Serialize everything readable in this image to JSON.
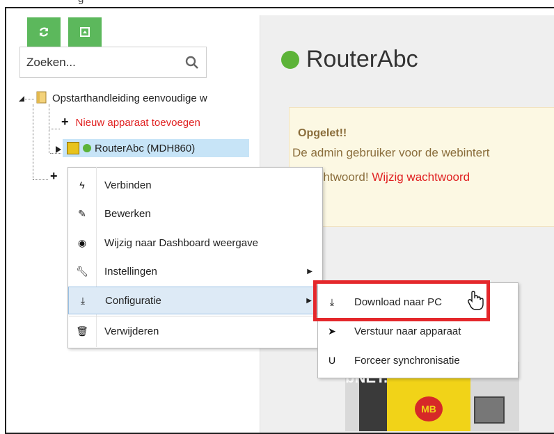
{
  "top_cut_text": "g",
  "toolbar": {
    "refresh_icon": "refresh-icon",
    "collapse_icon": "collapse-icon"
  },
  "search": {
    "placeholder": "Zoeken..."
  },
  "tree": {
    "root_label": "Opstarthandleiding eenvoudige w",
    "add_device_label": "Nieuw apparaat toevoegen",
    "router_label": "RouterAbc (MDH860)"
  },
  "panel": {
    "title": "RouterAbc",
    "alert_title": "Opgelet!!",
    "alert_line1": "De admin gebruiker voor de webintert",
    "alert_line2_prefix": "n wachtwoord!",
    "alert_link": "Wijzig wachtwoord"
  },
  "device": {
    "side_text": "bNET.",
    "logo": "MB"
  },
  "context_menu": {
    "items": [
      {
        "label": "Verbinden",
        "icon": "bolt-icon"
      },
      {
        "label": "Bewerken",
        "icon": "edit-icon"
      },
      {
        "label": "Wijzig naar Dashboard weergave",
        "icon": "dashboard-icon"
      },
      {
        "label": "Instellingen",
        "icon": "wrench-icon"
      },
      {
        "label": "Configuratie",
        "icon": "download-icon"
      },
      {
        "label": "Verwijderen",
        "icon": "trash-icon"
      }
    ]
  },
  "submenu": {
    "items": [
      {
        "label": "Download naar PC",
        "icon": "download-icon"
      },
      {
        "label": "Verstuur naar apparaat",
        "icon": "send-icon"
      },
      {
        "label": "Forceer synchronisatie",
        "icon": "magnet-icon"
      }
    ]
  },
  "colors": {
    "green": "#5cb85c",
    "status_green": "#5cb338",
    "red": "#e02020",
    "highlight_red": "#e4272b",
    "selection_blue": "#c7e4f7"
  }
}
